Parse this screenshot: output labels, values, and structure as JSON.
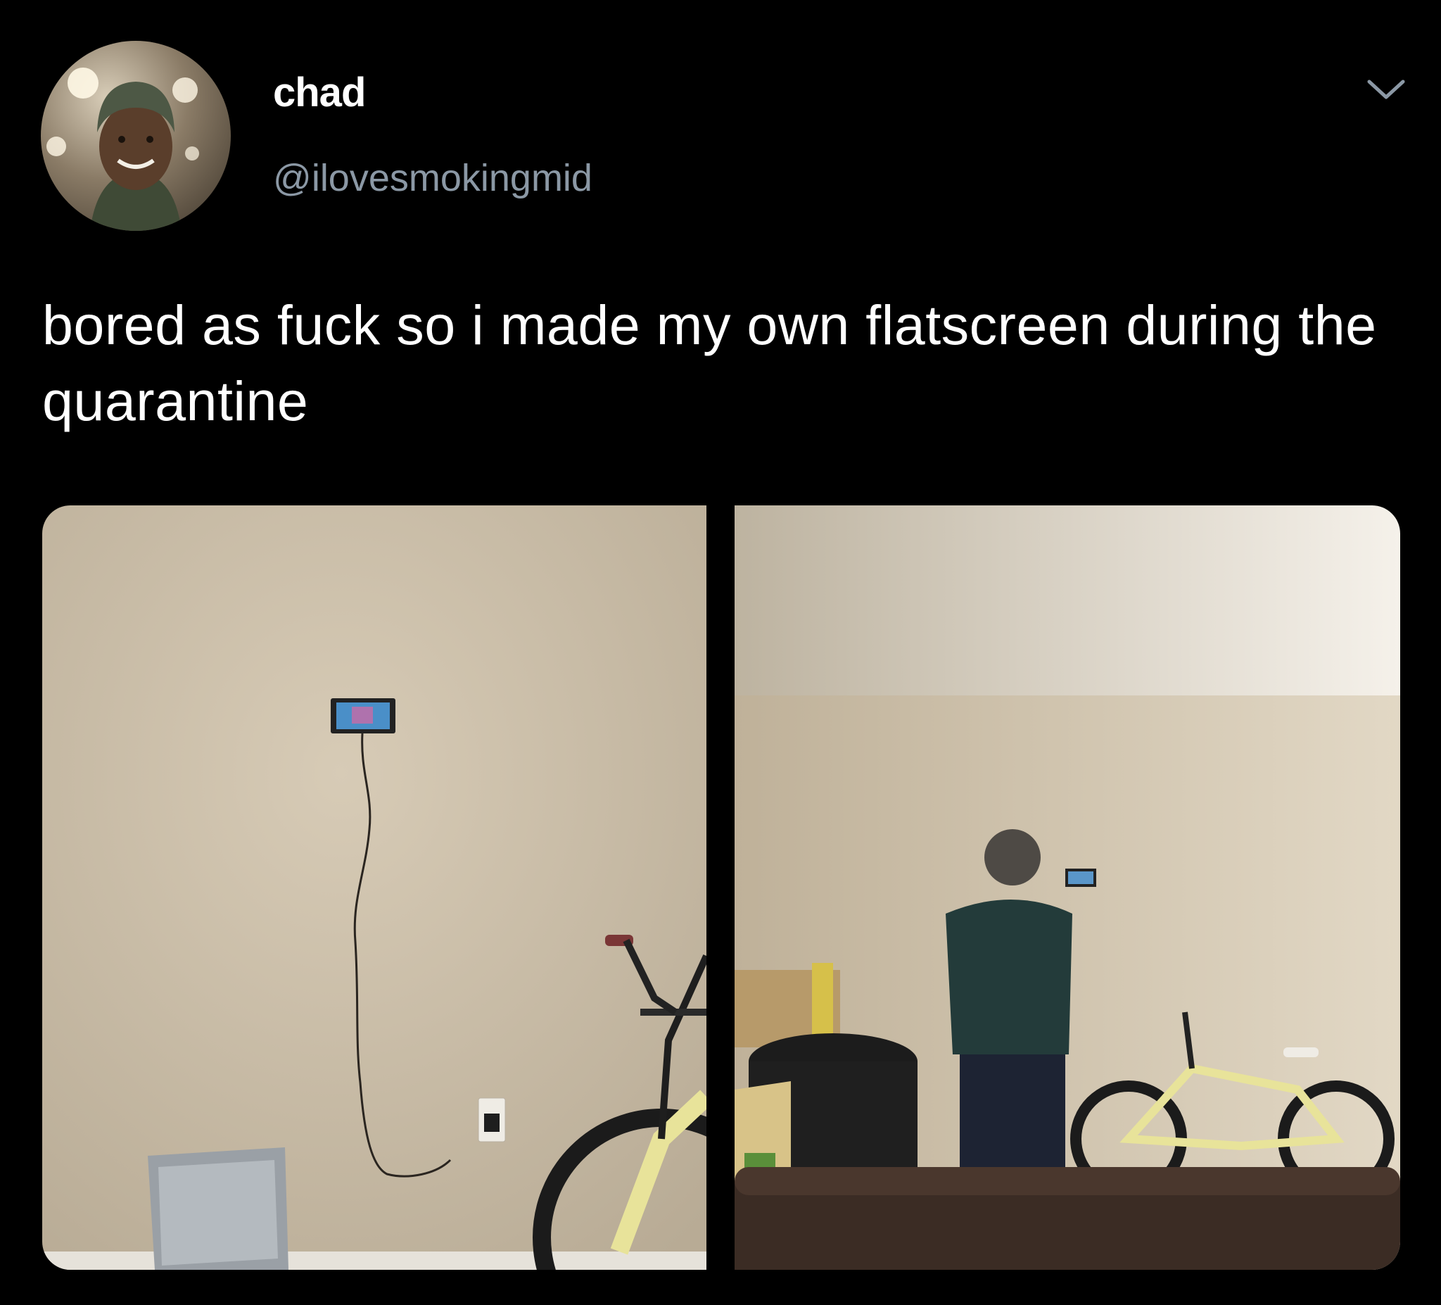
{
  "tweet": {
    "display_name": "chad",
    "handle": "@ilovesmokingmid",
    "text": "bored as fuck so i made my own flatscreen during the quarantine",
    "media": {
      "count": 2
    }
  },
  "icons": {
    "more": "chevron-down-icon"
  },
  "colors": {
    "background": "#000000",
    "text": "#ffffff",
    "handle": "#8b98a5",
    "wall": "#cbbfaa",
    "bike_frame": "#e8e39a"
  }
}
